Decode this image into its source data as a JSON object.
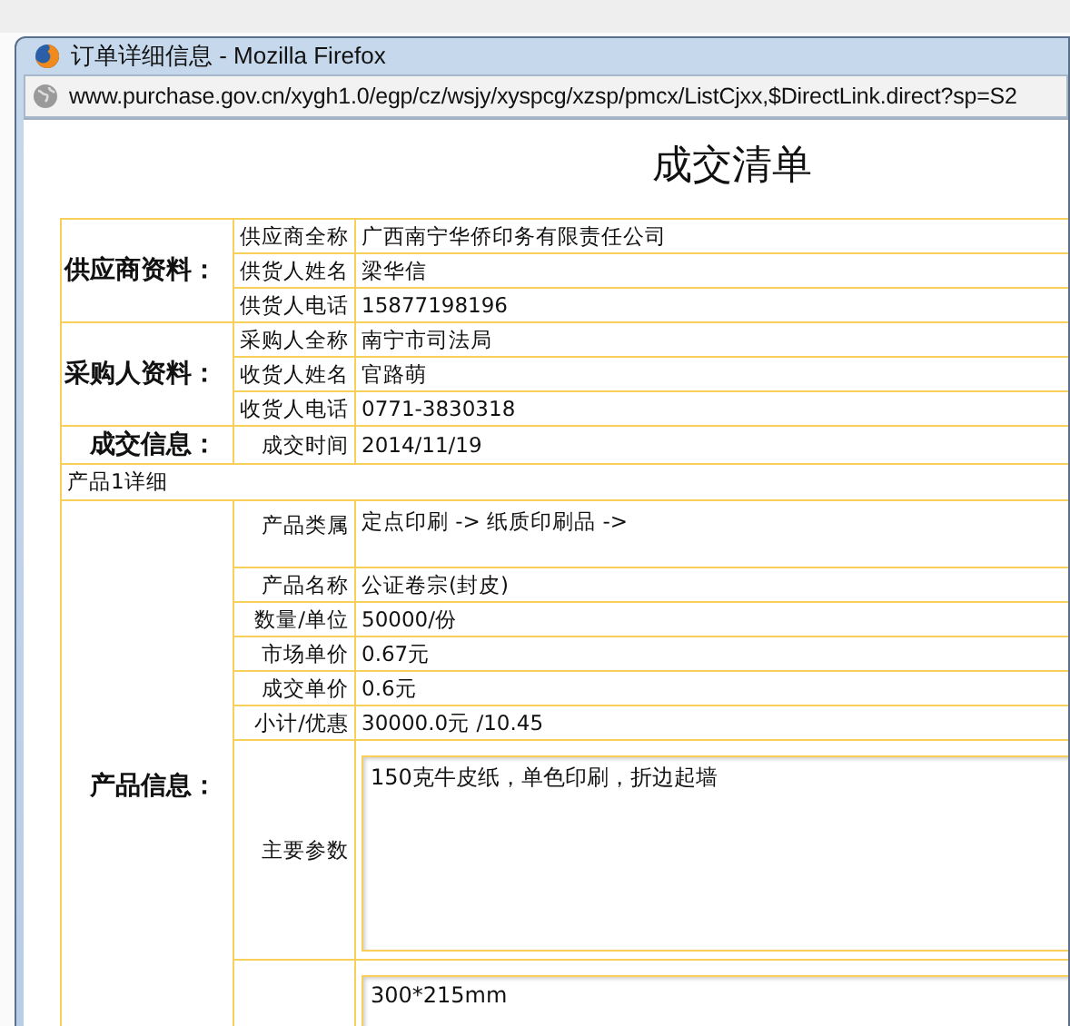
{
  "window": {
    "title": "订单详细信息 - Mozilla Firefox",
    "url": "www.purchase.gov.cn/xygh1.0/egp/cz/wsjy/xyspcg/xzsp/pmcx/ListCjxx,$DirectLink.direct?sp=S2"
  },
  "page_title": "成交清单",
  "sections": [
    {
      "heading": "供应商资料：",
      "fields": [
        {
          "label": "供应商全称",
          "value": "广西南宁华侨印务有限责任公司"
        },
        {
          "label": "供货人姓名",
          "value": "梁华信"
        },
        {
          "label": "供货人电话",
          "value": "15877198196"
        }
      ]
    },
    {
      "heading": "采购人资料：",
      "fields": [
        {
          "label": "采购人全称",
          "value": "南宁市司法局"
        },
        {
          "label": "收货人姓名",
          "value": "官路萌"
        },
        {
          "label": "收货人电话",
          "value": "0771-3830318"
        }
      ]
    },
    {
      "heading": "成交信息：",
      "fields": [
        {
          "label": "成交时间",
          "value": "2014/11/19"
        }
      ]
    }
  ],
  "product_heading": "产品1详细",
  "product": {
    "heading": "产品信息：",
    "fields": [
      {
        "kind": "tall",
        "label": "产品类属",
        "value": "定点印刷 -> 纸质印刷品 ->"
      },
      {
        "kind": "text",
        "label": "产品名称",
        "value": "公证卷宗(封皮)"
      },
      {
        "kind": "text",
        "label": "数量/单位",
        "value": "50000/份"
      },
      {
        "kind": "text",
        "label": "市场单价",
        "value": "0.67元"
      },
      {
        "kind": "text",
        "label": "成交单价",
        "value": "0.6元"
      },
      {
        "kind": "text",
        "label": "小计/优惠",
        "value": "30000.0元 /10.45"
      },
      {
        "kind": "textarea",
        "label": "主要参数",
        "value": "150克牛皮纸，单色印刷，折边起墙"
      },
      {
        "kind": "cutarea",
        "value": "300*215mm"
      }
    ]
  }
}
